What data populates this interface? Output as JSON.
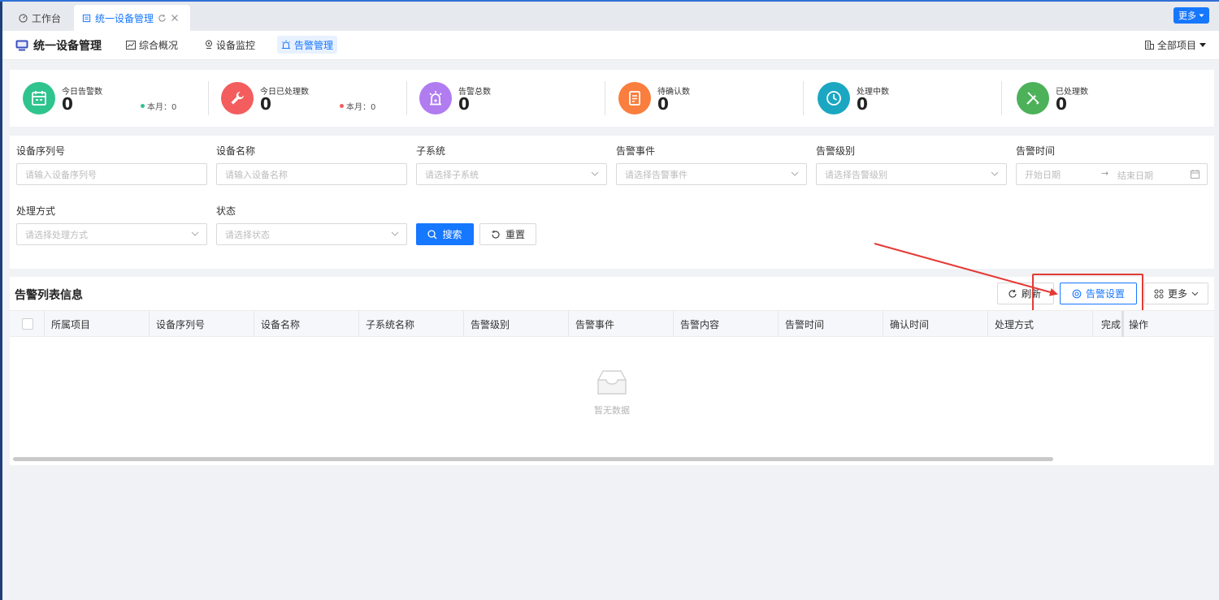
{
  "tabs": [
    {
      "label": "工作台"
    },
    {
      "label": "统一设备管理"
    }
  ],
  "more_tabs_label": "更多",
  "header": {
    "app_title": "统一设备管理",
    "nav": [
      "综合概况",
      "设备监控",
      "告警管理"
    ],
    "project_selector": "全部项目"
  },
  "stats": [
    {
      "label": "今日告警数",
      "value": "0",
      "month": "本月：0",
      "color": "#2fc48e",
      "dot_color": "#2fc48e"
    },
    {
      "label": "今日已处理数",
      "value": "0",
      "month": "本月：0",
      "color": "#f35d5d",
      "dot_color": "#f35d5d"
    },
    {
      "label": "告警总数",
      "value": "0",
      "color": "#b07cf0"
    },
    {
      "label": "待确认数",
      "value": "0",
      "color": "#fa7e3e"
    },
    {
      "label": "处理中数",
      "value": "0",
      "color": "#1ba7c2"
    },
    {
      "label": "已处理数",
      "value": "0",
      "color": "#4cb159"
    }
  ],
  "filters": {
    "serial": {
      "label": "设备序列号",
      "placeholder": "请输入设备序列号"
    },
    "name": {
      "label": "设备名称",
      "placeholder": "请输入设备名称"
    },
    "subsystem": {
      "label": "子系统",
      "placeholder": "请选择子系统"
    },
    "event": {
      "label": "告警事件",
      "placeholder": "请选择告警事件"
    },
    "level": {
      "label": "告警级别",
      "placeholder": "请选择告警级别"
    },
    "time": {
      "label": "告警时间",
      "start_placeholder": "开始日期",
      "end_placeholder": "结束日期"
    },
    "method": {
      "label": "处理方式",
      "placeholder": "请选择处理方式"
    },
    "status": {
      "label": "状态",
      "placeholder": "请选择状态"
    },
    "search_label": "搜索",
    "reset_label": "重置"
  },
  "list": {
    "title": "告警列表信息",
    "refresh_label": "刷新",
    "settings_label": "告警设置",
    "more_label": "更多",
    "columns": [
      "所属项目",
      "设备序列号",
      "设备名称",
      "子系统名称",
      "告警级别",
      "告警事件",
      "告警内容",
      "告警时间",
      "确认时间",
      "处理方式",
      "完成时间",
      "操作"
    ],
    "empty_text": "暂无数据"
  },
  "colors": {
    "primary": "#1677ff",
    "annotation": "#e53935"
  }
}
